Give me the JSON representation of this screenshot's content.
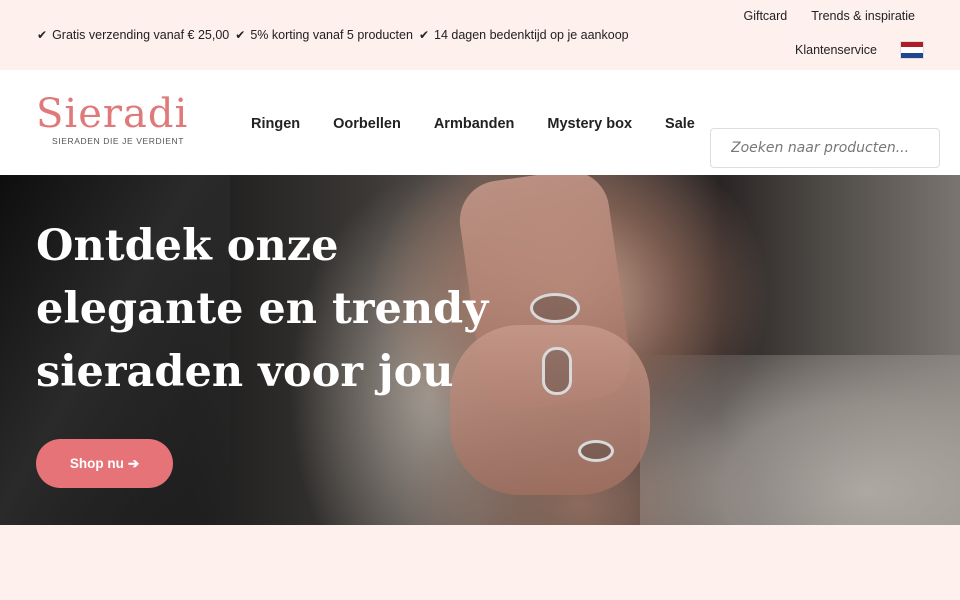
{
  "usps": [
    {
      "icon": "check-icon",
      "text": "Gratis verzending vanaf € 25,00"
    },
    {
      "icon": "check-icon",
      "text": "5% korting vanaf 5 producten"
    },
    {
      "icon": "check-icon",
      "text": "14 dagen bedenktijd op je aankoop"
    }
  ],
  "top_links": {
    "giftcard": "Giftcard",
    "trends": "Trends & inspiratie",
    "service": "Klantenservice"
  },
  "language_flag": {
    "icon": "flag-nl-icon",
    "colors": [
      "#ae1c28",
      "#ffffff",
      "#21468b"
    ]
  },
  "logo": {
    "word": "Sieradi",
    "tagline": "SIERADEN DIE JE VERDIENT"
  },
  "nav": [
    "Ringen",
    "Oorbellen",
    "Armbanden",
    "Mystery box",
    "Sale"
  ],
  "search": {
    "placeholder": "Zoeken naar producten...",
    "value": ""
  },
  "hero": {
    "title_lines": [
      "Ontdek onze",
      "elegante en trendy",
      "sieraden voor jou"
    ],
    "button_label": "Shop nu",
    "button_icon": "arrow-right-icon"
  },
  "colors": {
    "brand": "#e07a7a",
    "button": "#e57378",
    "topbar_bg": "#fdf0ed"
  }
}
